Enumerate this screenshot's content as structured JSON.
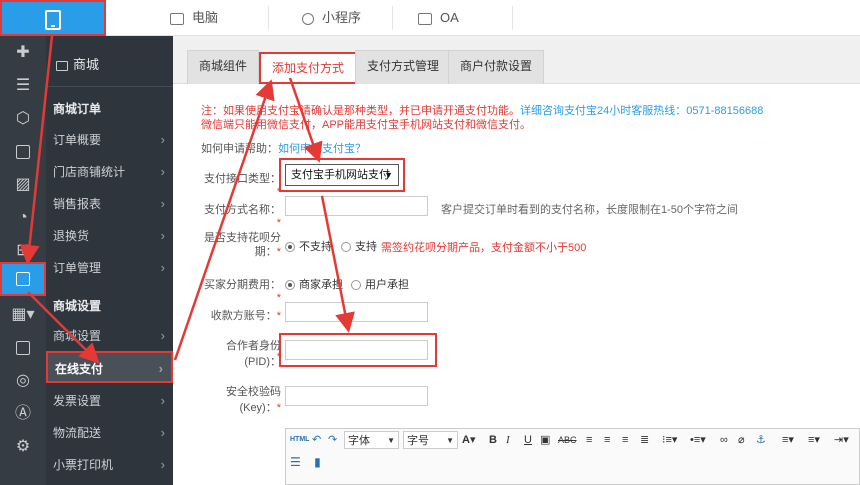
{
  "topbar": {
    "tabs": [
      {
        "label": "电脑",
        "icon": "monitor-icon"
      },
      {
        "label": "小程序",
        "icon": "mini-program-icon"
      },
      {
        "label": "OA",
        "icon": "calendar-icon"
      }
    ]
  },
  "sidebar": {
    "title": "商城",
    "group1_title": "商城订单",
    "group1_items": [
      {
        "label": "订单概要"
      },
      {
        "label": "门店商铺统计"
      },
      {
        "label": "销售报表"
      },
      {
        "label": "退换货"
      },
      {
        "label": "订单管理"
      }
    ],
    "group2_title": "商城设置",
    "group2_items": [
      {
        "label": "商城设置"
      },
      {
        "label": "在线支付"
      },
      {
        "label": "发票设置"
      },
      {
        "label": "物流配送"
      },
      {
        "label": "小票打印机"
      }
    ]
  },
  "main": {
    "tabs": [
      {
        "label": "商城组件"
      },
      {
        "label": "添加支付方式"
      },
      {
        "label": "支付方式管理"
      },
      {
        "label": "商户付款设置"
      }
    ],
    "note_line1": "注：如果使用支付宝请确认是那种类型，并已申请开通支付功能。",
    "note_line1_link": "详细咨询支付宝24小时客服热线：0571-88156688",
    "note_line2": "微信端只能用微信支付，APP能用支付宝手机网站支付和微信支付。",
    "how_label": "如何申请帮助：",
    "how_link": "如何申请支付宝？",
    "form": {
      "interface_label": "支付接口类型：",
      "interface_value": "支付宝手机网站支付",
      "method_name_label": "支付方式名称：",
      "method_name_hint": "客户提交订单时看到的支付名称，长度限制在1-50个字符之间",
      "huabei_label_1": "是否支持花呗分",
      "huabei_label_2": "期：",
      "huabei_no": "不支持",
      "huabei_yes": "支持",
      "huabei_warn": "需签约花呗分期产品，支付金额不小于500",
      "fee_label": "买家分期费用：",
      "fee_merchant": "商家承担",
      "fee_user": "用户承担",
      "account_label": "收款方账号：",
      "pid_label": "合作者身份(PID)：",
      "key_label_1": "安全校验码",
      "key_label_2": "(Key)："
    },
    "editor": {
      "html_btn": "HTML",
      "font_family": "字体",
      "font_size": "字号"
    }
  },
  "colors": {
    "accent": "#2a9de8",
    "highlight": "#e53935",
    "sidebar_bg": "#2f353d"
  }
}
